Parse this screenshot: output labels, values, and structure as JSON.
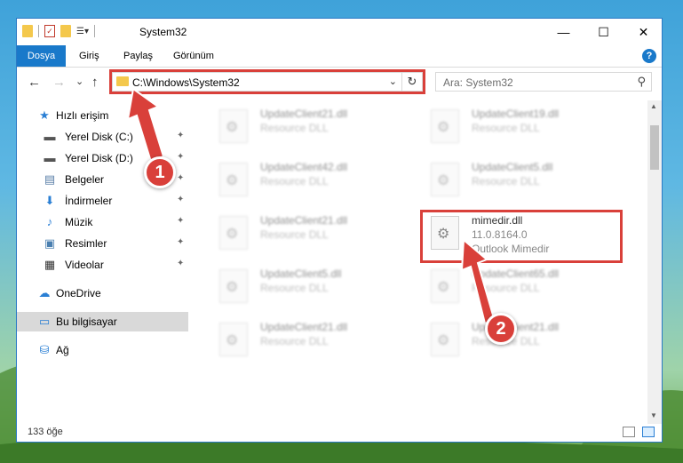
{
  "window": {
    "title": "System32",
    "min_glyph": "—",
    "max_glyph": "☐",
    "close_glyph": "✕"
  },
  "ribbon": {
    "tabs": [
      "Dosya",
      "Giriş",
      "Paylaş",
      "Görünüm"
    ],
    "help_glyph": "?"
  },
  "navbar": {
    "back_glyph": "←",
    "forward_glyph": "→",
    "recent_glyph": "⌄",
    "up_glyph": "↑",
    "address_path": "C:\\Windows\\System32",
    "address_chevron": "⌄",
    "refresh_glyph": "↻",
    "search_placeholder": "Ara: System32",
    "search_icon_glyph": "⚲"
  },
  "sidebar": {
    "items": [
      {
        "label": "Hızlı erişim",
        "icon": "star-icon",
        "pinned": false
      },
      {
        "label": "Yerel Disk (C:)",
        "icon": "drive-icon",
        "pinned": true
      },
      {
        "label": "Yerel Disk (D:)",
        "icon": "drive-icon",
        "pinned": true
      },
      {
        "label": "Belgeler",
        "icon": "document-icon",
        "pinned": true
      },
      {
        "label": "İndirmeler",
        "icon": "download-icon",
        "pinned": true
      },
      {
        "label": "Müzik",
        "icon": "music-icon",
        "pinned": true
      },
      {
        "label": "Resimler",
        "icon": "picture-icon",
        "pinned": true
      },
      {
        "label": "Videolar",
        "icon": "video-icon",
        "pinned": true
      },
      {
        "label": "OneDrive",
        "icon": "cloud-icon",
        "pinned": false
      },
      {
        "label": "Bu bilgisayar",
        "icon": "computer-icon",
        "pinned": false,
        "selected": true
      },
      {
        "label": "Ağ",
        "icon": "network-icon",
        "pinned": false
      }
    ],
    "pin_glyph": "📌"
  },
  "files": [
    {
      "name": "UpdateClient21.dll",
      "desc": "Resource DLL",
      "blurred": true
    },
    {
      "name": "UpdateClient19.dll",
      "desc": "Resource DLL",
      "blurred": true
    },
    {
      "name": "UpdateClient42.dll",
      "desc": "Resource DLL",
      "blurred": true
    },
    {
      "name": "UpdateClient5.dll",
      "desc": "Resource DLL",
      "blurred": true
    },
    {
      "name": "UpdateClient21.dll",
      "desc": "Resource DLL",
      "blurred": true
    },
    {
      "name": "mimedir.dll",
      "desc": "11.0.8164.0",
      "desc2": "Outlook Mimedir",
      "blurred": false
    },
    {
      "name": "UpdateClient5.dll",
      "desc": "Resource DLL",
      "blurred": true
    },
    {
      "name": "UpdateClient65.dll",
      "desc": "Resource DLL",
      "blurred": true
    },
    {
      "name": "UpdateClient21.dll",
      "desc": "Resource DLL",
      "blurred": true
    },
    {
      "name": "UpdateClient21.dll",
      "desc": "Resource DLL",
      "blurred": true
    }
  ],
  "status": {
    "count": "133 öğe"
  },
  "annotations": {
    "badge1": "1",
    "badge2": "2",
    "highlight_color": "#d9403a"
  },
  "colors": {
    "accent": "#1979ca",
    "selected_bg": "#d9d9d9"
  }
}
